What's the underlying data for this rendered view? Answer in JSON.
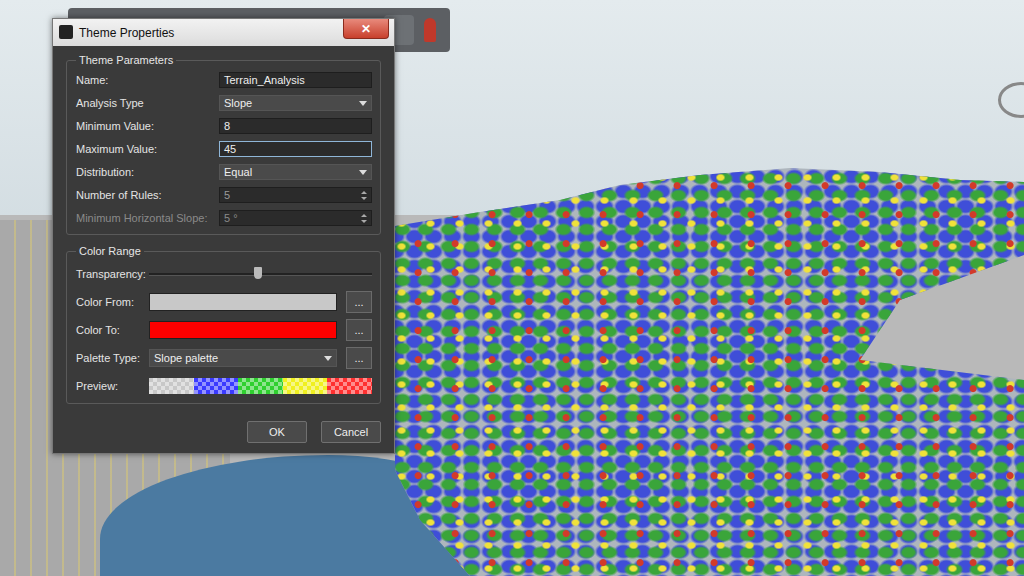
{
  "window": {
    "title": "Theme Properties",
    "close": "✕"
  },
  "theme_parameters": {
    "title": "Theme Parameters",
    "fields": [
      {
        "label": "Name:",
        "value": "Terrain_Analysis",
        "kind": "text",
        "focused": false,
        "disabled": false
      },
      {
        "label": "Analysis Type",
        "value": "Slope",
        "kind": "select",
        "focused": false,
        "disabled": false
      },
      {
        "label": "Minimum Value:",
        "value": "8",
        "kind": "text",
        "focused": false,
        "disabled": false
      },
      {
        "label": "Maximum Value:",
        "value": "45",
        "kind": "text",
        "focused": true,
        "disabled": false
      },
      {
        "label": "Distribution:",
        "value": "Equal",
        "kind": "select",
        "focused": false,
        "disabled": false
      },
      {
        "label": "Number of Rules:",
        "value": "5",
        "kind": "spinner",
        "focused": false,
        "disabled": false
      },
      {
        "label": "Minimum Horizontal Slope:",
        "value": "5 °",
        "kind": "spinner",
        "focused": false,
        "disabled": true
      }
    ]
  },
  "color_range": {
    "title": "Color Range",
    "rows": [
      {
        "label": "Transparency:",
        "kind": "slider",
        "level": 0.49
      },
      {
        "label": "Color From:",
        "kind": "color",
        "color": "#c8c8c8",
        "button": "..."
      },
      {
        "label": "Color To:",
        "kind": "color",
        "color": "#ff0000",
        "button": "..."
      },
      {
        "label": "Palette  Type:",
        "kind": "select",
        "value": "Slope palette",
        "button": "..."
      },
      {
        "label": "Preview:",
        "kind": "preview",
        "swatches": [
          {
            "color": "#c8c8c8"
          },
          {
            "color": "#3a3aff"
          },
          {
            "color": "#2fd02f"
          },
          {
            "color": "#f0f020"
          },
          {
            "color": "#ff3030"
          }
        ]
      }
    ]
  },
  "buttons": [
    {
      "label": "OK"
    },
    {
      "label": "Cancel"
    }
  ]
}
